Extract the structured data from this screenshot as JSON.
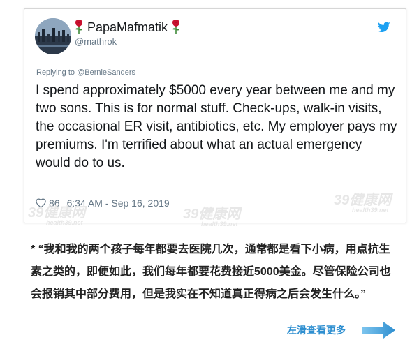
{
  "tweet": {
    "display_name": "PapaMafmatik",
    "handle": "@mathrok",
    "reply_to": "Replying to @BernieSanders",
    "body": "I spend approximately $5000 every year between me and my two sons.  This is for normal stuff. Check-ups, walk-in visits, the occasional ER visit, antibiotics, etc. My employer pays my premiums. I'm terrified about what an actual emergency would do to us.",
    "likes": "86",
    "timestamp": "6:34 AM - Sep 16, 2019",
    "icons": [
      "rose-emoji-icon",
      "twitter-bird-icon",
      "heart-icon"
    ],
    "brand_color": "#1da1f2"
  },
  "watermark": {
    "text": "39健康网",
    "subtext": "health39.net"
  },
  "caption": {
    "text": "* “我和我的两个孩子每年都要去医院几次，通常都是看下小病，用点抗生素之类的，即便如此，我们每年都要花费接近5000美金。尽管保险公司也会报销其中部分费用，但是我实在不知道真正得病之后会发生什么。”"
  },
  "swipe_hint": {
    "label": "左滑查看更多",
    "color": "#2f8fd0",
    "icon": "arrow-right-icon"
  }
}
